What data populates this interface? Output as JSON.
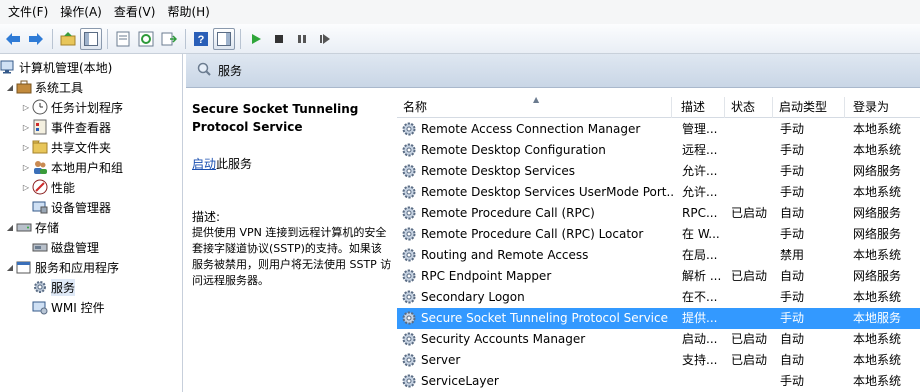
{
  "menu": [
    "文件(F)",
    "操作(A)",
    "查看(V)",
    "帮助(H)"
  ],
  "tree": {
    "root": "计算机管理(本地)",
    "system_tools": "系统工具",
    "task_scheduler": "任务计划程序",
    "event_viewer": "事件查看器",
    "shared_folders": "共享文件夹",
    "local_users": "本地用户和组",
    "performance": "性能",
    "device_manager": "设备管理器",
    "storage": "存储",
    "disk_mgmt": "磁盘管理",
    "services_apps": "服务和应用程序",
    "services": "服务",
    "wmi": "WMI 控件"
  },
  "panel": {
    "title": "服务",
    "selected_service_title": "Secure Socket Tunneling Protocol Service",
    "start_link": "启动",
    "start_suffix": "此服务",
    "desc_label": "描述:",
    "desc_text": "提供使用 VPN 连接到远程计算机的安全套接字隧道协议(SSTP)的支持。如果该服务被禁用，则用户将无法使用 SSTP 访问远程服务器。"
  },
  "columns": {
    "name": "名称",
    "desc": "描述",
    "status": "状态",
    "startup": "启动类型",
    "logon": "登录为"
  },
  "rows": [
    {
      "name": "Remote Access Connection Manager",
      "desc": "管理...",
      "status": "",
      "startup": "手动",
      "logon": "本地系统"
    },
    {
      "name": "Remote Desktop Configuration",
      "desc": "远程...",
      "status": "",
      "startup": "手动",
      "logon": "本地系统"
    },
    {
      "name": "Remote Desktop Services",
      "desc": "允许...",
      "status": "",
      "startup": "手动",
      "logon": "网络服务"
    },
    {
      "name": "Remote Desktop Services UserMode Port...",
      "desc": "允许...",
      "status": "",
      "startup": "手动",
      "logon": "本地系统"
    },
    {
      "name": "Remote Procedure Call (RPC)",
      "desc": "RPC...",
      "status": "已启动",
      "startup": "自动",
      "logon": "网络服务"
    },
    {
      "name": "Remote Procedure Call (RPC) Locator",
      "desc": "在 W...",
      "status": "",
      "startup": "手动",
      "logon": "网络服务"
    },
    {
      "name": "Routing and Remote Access",
      "desc": "在局...",
      "status": "",
      "startup": "禁用",
      "logon": "本地系统"
    },
    {
      "name": "RPC Endpoint Mapper",
      "desc": "解析 ...",
      "status": "已启动",
      "startup": "自动",
      "logon": "网络服务"
    },
    {
      "name": "Secondary Logon",
      "desc": "在不...",
      "status": "",
      "startup": "手动",
      "logon": "本地系统"
    },
    {
      "name": "Secure Socket Tunneling Protocol Service",
      "desc": "提供...",
      "status": "",
      "startup": "手动",
      "logon": "本地服务"
    },
    {
      "name": "Security Accounts Manager",
      "desc": "启动...",
      "status": "已启动",
      "startup": "自动",
      "logon": "本地系统"
    },
    {
      "name": "Server",
      "desc": "支持...",
      "status": "已启动",
      "startup": "自动",
      "logon": "本地系统"
    },
    {
      "name": "ServiceLayer",
      "desc": "",
      "status": "",
      "startup": "手动",
      "logon": "本地系统"
    }
  ],
  "colors": {
    "selection": "#3399ff",
    "tree_selection": "#dfe9f7",
    "link": "#1a4fb0",
    "header_grad_top": "#dfe7f1"
  }
}
